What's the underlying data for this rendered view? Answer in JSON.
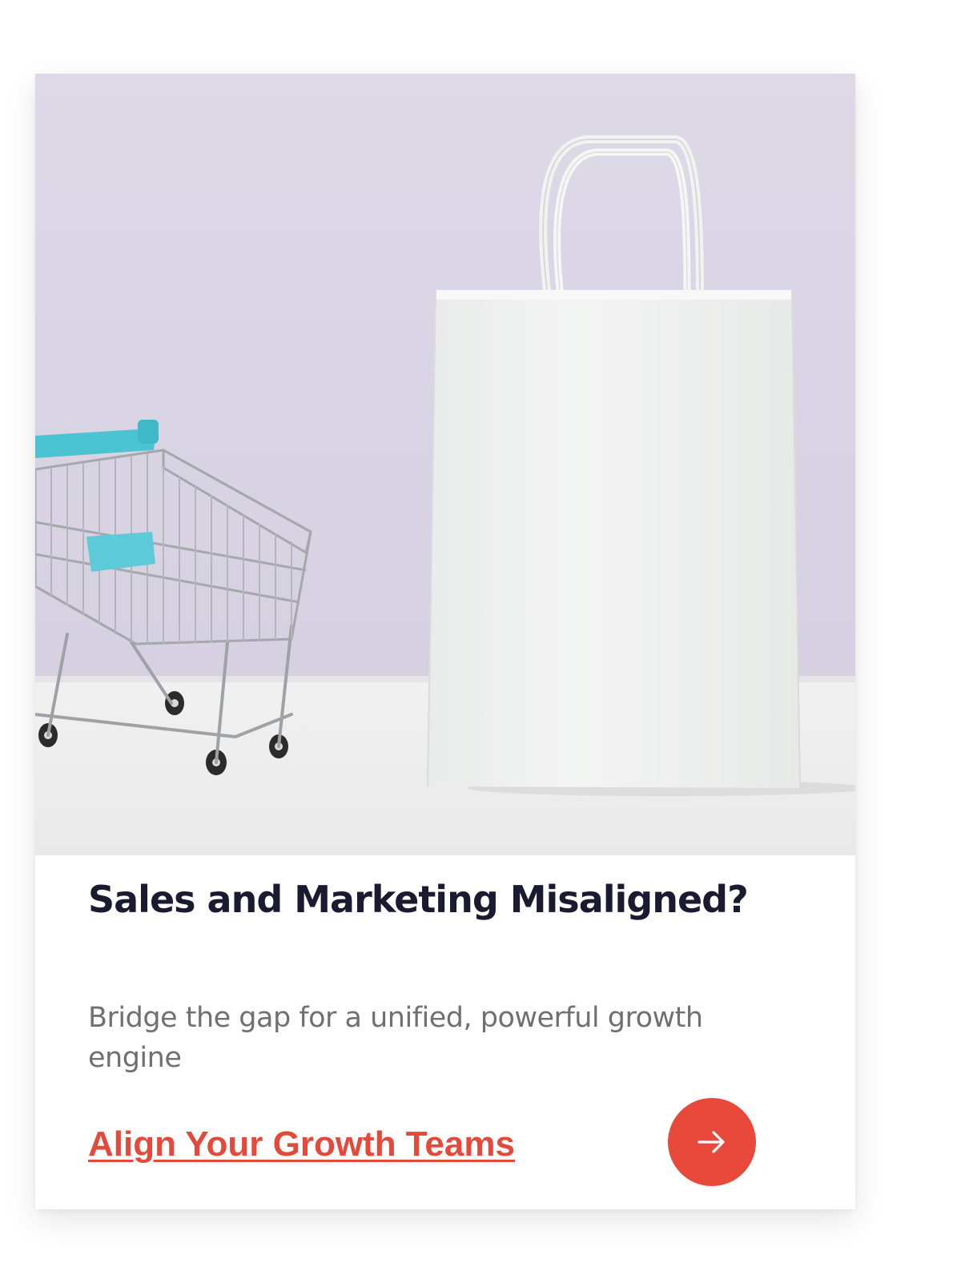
{
  "card": {
    "image_alt": "Miniature shopping cart beside a white paper shopping bag",
    "title": "Sales and Marketing Misaligned?",
    "description": "Bridge the gap for a unified, powerful growth engine",
    "cta_label": "Align Your Growth Teams",
    "cta_icon": "arrow-right-icon"
  },
  "colors": {
    "accent": "#e8493b",
    "title": "#1b1a31",
    "body_text": "#707070",
    "hero_wall": "#dcd7e6",
    "hero_table": "#eeeeee",
    "cart_handle": "#4cc3d3"
  }
}
